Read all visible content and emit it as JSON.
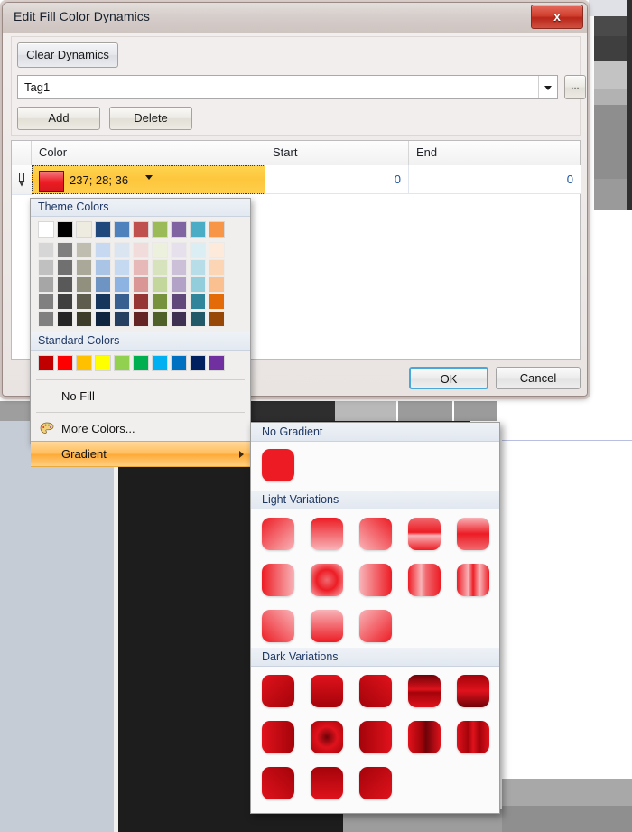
{
  "dialog": {
    "title": "Edit Fill Color Dynamics",
    "close_label": "x",
    "clear_dynamics_label": "Clear Dynamics",
    "tag_value": "Tag1",
    "tag_placeholder": "Tag1",
    "ellipsis_label": "...",
    "add_label": "Add",
    "delete_label": "Delete",
    "ok_label": "OK",
    "cancel_label": "Cancel"
  },
  "grid": {
    "columns": [
      "",
      "Color",
      "Start",
      "End"
    ],
    "rows": [
      {
        "indicator": "pencil-icon",
        "color_value": "237; 28; 36",
        "color_hex": "#ED1C24",
        "start": "0",
        "end": "0"
      }
    ]
  },
  "color_menu": {
    "theme_section_label": "Theme Colors",
    "theme_base": [
      "#ffffff",
      "#000000",
      "#eeece1",
      "#1f497d",
      "#4f81bd",
      "#c0504d",
      "#9bbb59",
      "#8064a2",
      "#4bacc6",
      "#f79646"
    ],
    "theme_tints": [
      [
        "#d6d6d6",
        "#7f7f7f",
        "#bfbdb0",
        "#c6d9f0",
        "#dbe5f1",
        "#f2dcdb",
        "#ebf1dd",
        "#e5e0ec",
        "#dbeef3",
        "#fdeada"
      ],
      [
        "#c0c0c0",
        "#707070",
        "#aaa899",
        "#aac4e5",
        "#c5d9f1",
        "#e6b8b7",
        "#d7e3bc",
        "#ccc0d9",
        "#b7dee8",
        "#fcd5b4"
      ],
      [
        "#a6a6a6",
        "#595959",
        "#918f7e",
        "#6e94c4",
        "#8db3e2",
        "#da9694",
        "#c3d69b",
        "#b2a2c7",
        "#92cddc",
        "#fac08f"
      ],
      [
        "#808080",
        "#3f3f3f",
        "#5e5c4c",
        "#16365c",
        "#376091",
        "#963634",
        "#76923c",
        "#60497a",
        "#31859b",
        "#e36c09"
      ],
      [
        "#808080",
        "#262626",
        "#3e3c2b",
        "#0f243e",
        "#254061",
        "#632423",
        "#4f6128",
        "#3f3151",
        "#215867",
        "#974806"
      ]
    ],
    "standard_section_label": "Standard Colors",
    "standard_colors": [
      "#c00000",
      "#ff0000",
      "#ffc000",
      "#ffff00",
      "#92d050",
      "#00b050",
      "#00b0f0",
      "#0070c0",
      "#002060",
      "#7030a0"
    ],
    "no_fill_label": "No Fill",
    "more_colors_label": "More Colors...",
    "gradient_label": "Gradient"
  },
  "gradient_menu": {
    "no_gradient_label": "No Gradient",
    "no_gradient_swatch": "#ed1c24",
    "light_label": "Light Variations",
    "dark_label": "Dark Variations",
    "light_count": 13,
    "dark_count": 13
  },
  "colors": {
    "accent_selected_cell": "#FFCF45",
    "highlight_gradient_item": "#FDAA36",
    "grid_number_text": "#17519E",
    "section_header_text": "#1F3864"
  }
}
